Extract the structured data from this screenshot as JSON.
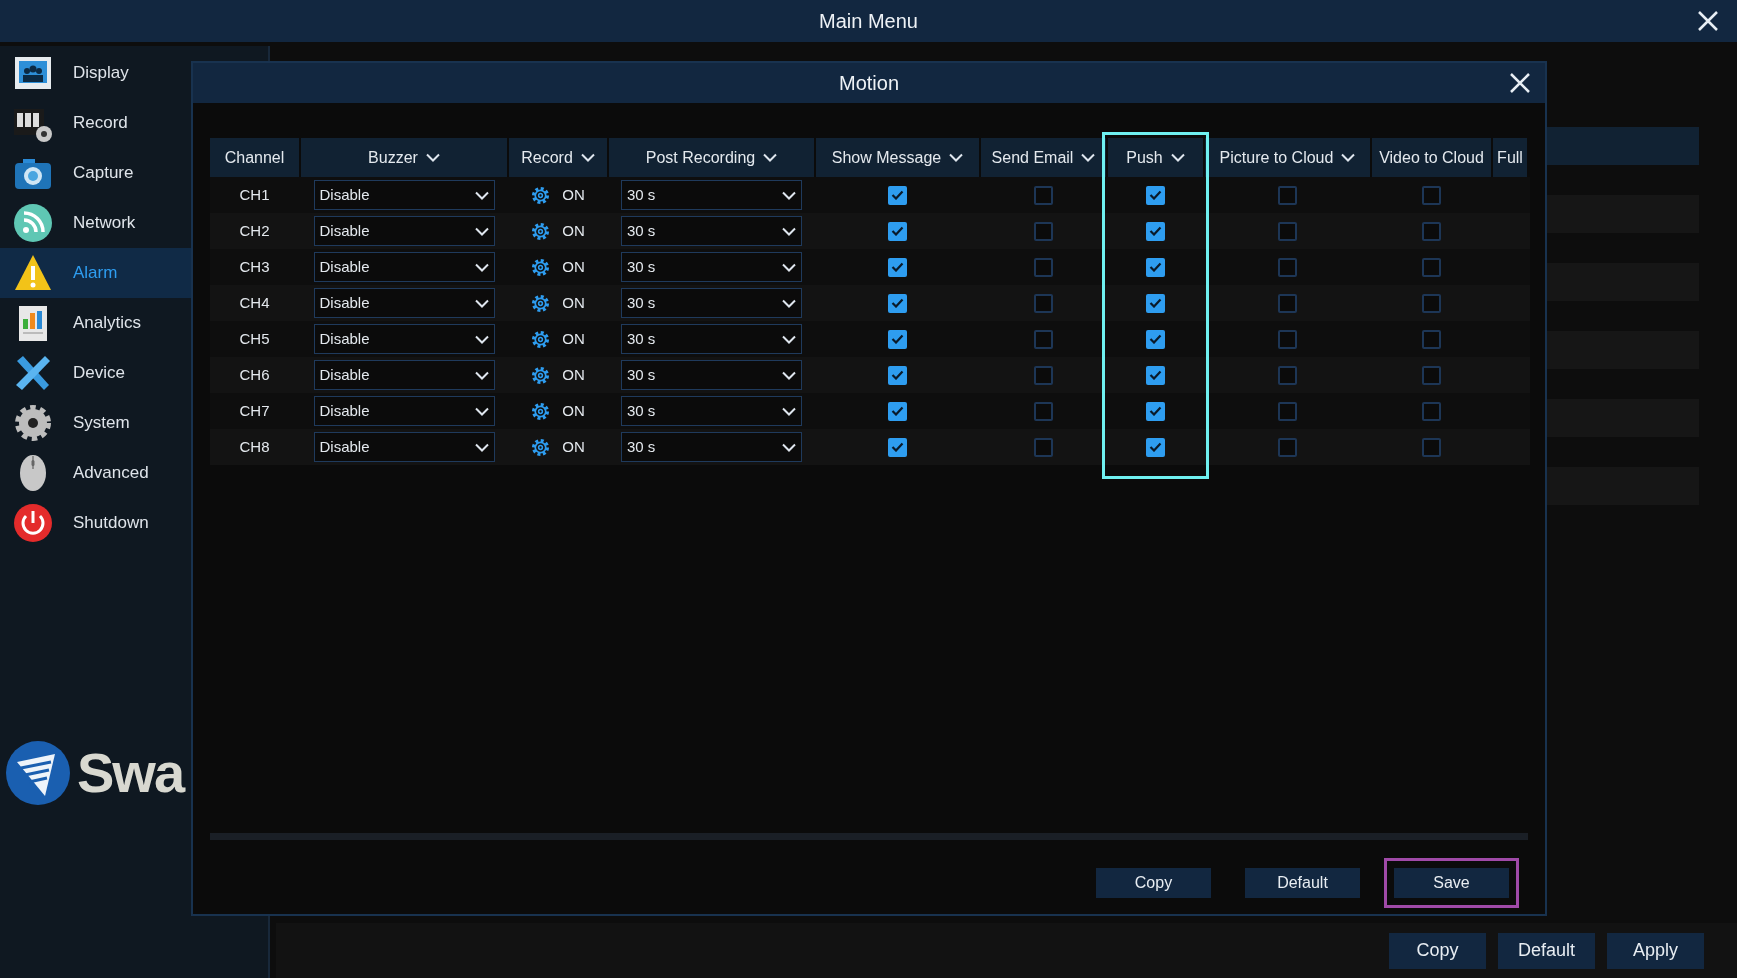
{
  "window": {
    "title": "Main Menu"
  },
  "sidebar": {
    "items": [
      {
        "label": "Display",
        "selected": false
      },
      {
        "label": "Record",
        "selected": false
      },
      {
        "label": "Capture",
        "selected": false
      },
      {
        "label": "Network",
        "selected": false
      },
      {
        "label": "Alarm",
        "selected": true
      },
      {
        "label": "Analytics",
        "selected": false
      },
      {
        "label": "Device",
        "selected": false
      },
      {
        "label": "System",
        "selected": false
      },
      {
        "label": "Advanced",
        "selected": false
      },
      {
        "label": "Shutdown",
        "selected": false
      }
    ],
    "logo_text": "Swa"
  },
  "dialog": {
    "title": "Motion",
    "table": {
      "columns": [
        {
          "label": "Channel",
          "dropdown": false,
          "highlighted": false
        },
        {
          "label": "Buzzer",
          "dropdown": true,
          "highlighted": false
        },
        {
          "label": "Record",
          "dropdown": true,
          "highlighted": false
        },
        {
          "label": "Post Recording",
          "dropdown": true,
          "highlighted": false
        },
        {
          "label": "Show Message",
          "dropdown": true,
          "highlighted": false
        },
        {
          "label": "Send Email",
          "dropdown": true,
          "highlighted": false
        },
        {
          "label": "Push",
          "dropdown": true,
          "highlighted": true
        },
        {
          "label": "Picture to Cloud",
          "dropdown": true,
          "highlighted": false
        },
        {
          "label": "Video to Cloud",
          "dropdown": false,
          "highlighted": false
        },
        {
          "label": "Full",
          "dropdown": false,
          "highlighted": false
        }
      ],
      "rows": [
        {
          "channel": "CH1",
          "buzzer": "Disable",
          "record": "ON",
          "post_recording": "30 s",
          "show_message": true,
          "send_email": false,
          "push": true,
          "picture_to_cloud": false,
          "video_to_cloud": false
        },
        {
          "channel": "CH2",
          "buzzer": "Disable",
          "record": "ON",
          "post_recording": "30 s",
          "show_message": true,
          "send_email": false,
          "push": true,
          "picture_to_cloud": false,
          "video_to_cloud": false
        },
        {
          "channel": "CH3",
          "buzzer": "Disable",
          "record": "ON",
          "post_recording": "30 s",
          "show_message": true,
          "send_email": false,
          "push": true,
          "picture_to_cloud": false,
          "video_to_cloud": false
        },
        {
          "channel": "CH4",
          "buzzer": "Disable",
          "record": "ON",
          "post_recording": "30 s",
          "show_message": true,
          "send_email": false,
          "push": true,
          "picture_to_cloud": false,
          "video_to_cloud": false
        },
        {
          "channel": "CH5",
          "buzzer": "Disable",
          "record": "ON",
          "post_recording": "30 s",
          "show_message": true,
          "send_email": false,
          "push": true,
          "picture_to_cloud": false,
          "video_to_cloud": false
        },
        {
          "channel": "CH6",
          "buzzer": "Disable",
          "record": "ON",
          "post_recording": "30 s",
          "show_message": true,
          "send_email": false,
          "push": true,
          "picture_to_cloud": false,
          "video_to_cloud": false
        },
        {
          "channel": "CH7",
          "buzzer": "Disable",
          "record": "ON",
          "post_recording": "30 s",
          "show_message": true,
          "send_email": false,
          "push": true,
          "picture_to_cloud": false,
          "video_to_cloud": false
        },
        {
          "channel": "CH8",
          "buzzer": "Disable",
          "record": "ON",
          "post_recording": "30 s",
          "show_message": true,
          "send_email": false,
          "push": true,
          "picture_to_cloud": false,
          "video_to_cloud": false
        }
      ]
    },
    "buttons": [
      {
        "label": "Copy",
        "highlighted": false
      },
      {
        "label": "Default",
        "highlighted": false
      },
      {
        "label": "Save",
        "highlighted": true
      }
    ]
  },
  "footer": {
    "buttons": [
      "Copy",
      "Default",
      "Apply"
    ]
  }
}
